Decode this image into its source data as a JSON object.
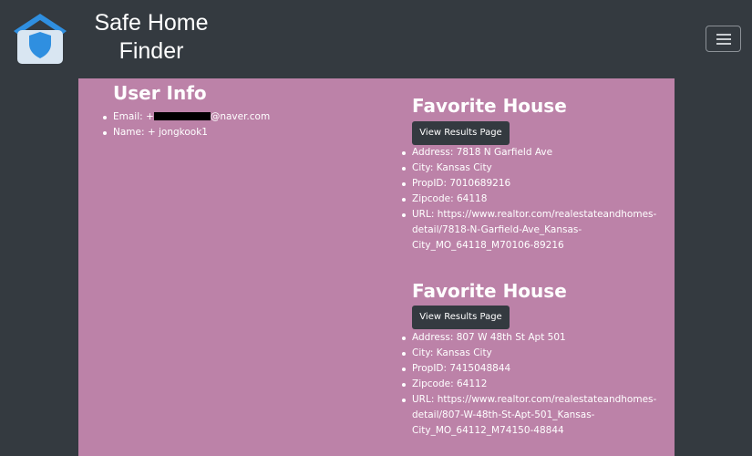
{
  "navbar": {
    "brand": "Safe Home Finder",
    "logo_icon": "shield-home-icon",
    "menu_icon": "hamburger-icon",
    "colors": {
      "bar": "#343a40",
      "logo_roof": "#2f8fe0",
      "logo_body": "#d9e6f2",
      "shield": "#2f8fe0"
    }
  },
  "panel": {
    "background": "#bc82a8",
    "user_info": {
      "title": "User Info",
      "email_prefix": "Email: +",
      "email_suffix": "@naver.com",
      "name": "Name: + jongkook1"
    },
    "favorites": [
      {
        "title": "Favorite House",
        "button_label": "View Results Page",
        "address": "Address: 7818 N Garfield Ave",
        "city": "City: Kansas City",
        "prop_id": "PropID: 7010689216",
        "zipcode": "Zipcode: 64118",
        "url_line1": "URL: https://www.realtor.com/realestateandhomes-",
        "url_line2": "detail/7818-N-Garfield-Ave_Kansas-",
        "url_line3": "City_MO_64118_M70106-89216"
      },
      {
        "title": "Favorite House",
        "button_label": "View Results Page",
        "address": "Address: 807 W 48th St Apt 501",
        "city": "City: Kansas City",
        "prop_id": "PropID: 7415048844",
        "zipcode": "Zipcode: 64112",
        "url_line1": "URL: https://www.realtor.com/realestateandhomes-",
        "url_line2": "detail/807-W-48th-St-Apt-501_Kansas-",
        "url_line3": "City_MO_64112_M74150-48844"
      }
    ]
  }
}
